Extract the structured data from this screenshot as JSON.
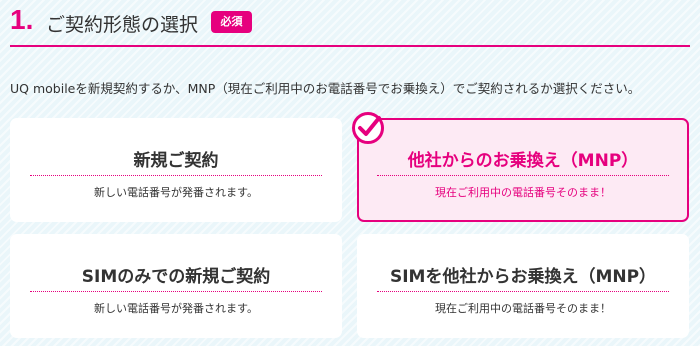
{
  "header": {
    "step_number": "1.",
    "title": "ご契約形態の選択",
    "required_badge": "必須"
  },
  "intro_text": "UQ mobileを新規契約するか、MNP（現在ご利用中のお電話番号でお乗換え）でご契約されるか選択ください。",
  "options": [
    {
      "title": "新規ご契約",
      "description": "新しい電話番号が発番されます。",
      "selected": false
    },
    {
      "title": "他社からのお乗換え（MNP）",
      "description": "現在ご利用中の電話番号そのまま！",
      "selected": true
    },
    {
      "title": "SIMのみでの新規ご契約",
      "description": "新しい電話番号が発番されます。",
      "selected": false
    },
    {
      "title": "SIMを他社からお乗換え（MNP）",
      "description": "現在ご利用中の電話番号そのまま！",
      "selected": false
    }
  ],
  "colors": {
    "accent": "#e6007e",
    "background": "#eaf6fa",
    "selected_background": "#fdeaf4"
  },
  "icons": {
    "selected_marker": "check-circle-icon"
  }
}
